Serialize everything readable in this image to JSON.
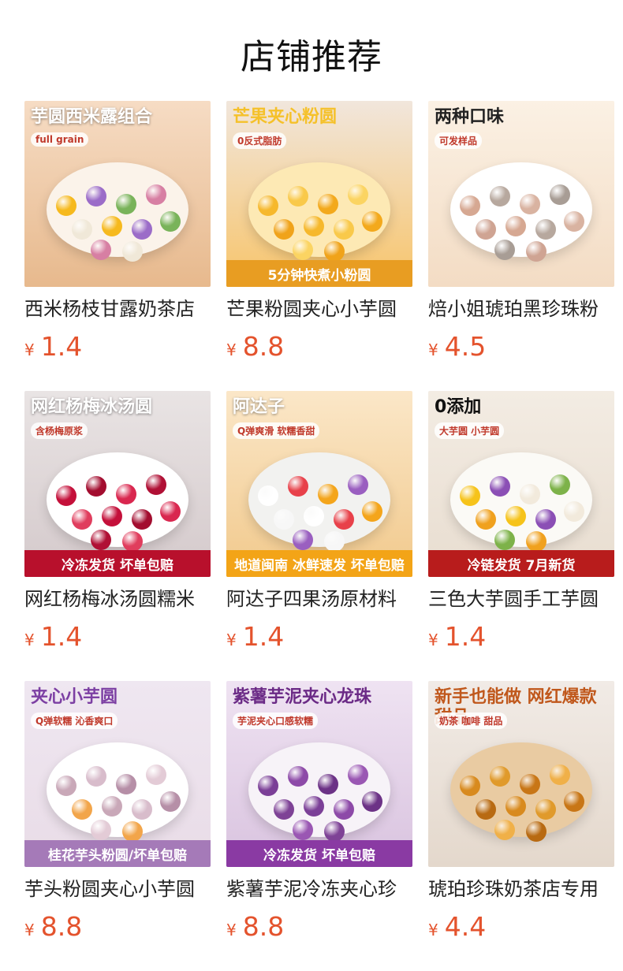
{
  "page_title": "店铺推荐",
  "currency": "¥",
  "products": [
    {
      "name": "西米杨枝甘露奶茶店",
      "price": "1.4",
      "image": {
        "headline": "芋圆西米露组合",
        "sub": "full grain",
        "banner": "",
        "top_color": "#f6dcc4",
        "bottom_color": "#e7b98d",
        "text_color": "#ffffff",
        "banner_color": "",
        "bowl_color": "#fbf3ea",
        "balls": [
          "#f6b91d",
          "#9b6cc8",
          "#79b35a",
          "#d77fa3",
          "#f0e8d8"
        ]
      }
    },
    {
      "name": "芒果粉圆夹心小芋圆",
      "price": "8.8",
      "image": {
        "headline": "芒果夹心粉圆",
        "sub": "0反式脂肪",
        "banner": "5分钟快煮小粉圆",
        "top_color": "#f1e6dc",
        "bottom_color": "#f7c46a",
        "text_color": "#f5c12a",
        "banner_color": "#e89d22",
        "bowl_color": "#fde9b4",
        "balls": [
          "#f6b82c",
          "#f9c94a",
          "#f3a91c",
          "#fbd462",
          "#f0a31a"
        ]
      }
    },
    {
      "name": "焙小姐琥珀黑珍珠粉",
      "price": "4.5",
      "image": {
        "headline": "两种口味",
        "sub": "可发样品",
        "banner": "",
        "top_color": "#fbf1e4",
        "bottom_color": "#f3dcc4",
        "text_color": "#222222",
        "banner_color": "",
        "bowl_color": "#ffffff",
        "balls": [
          "#d6a892",
          "#b7a89e",
          "#d9b3a1",
          "#a89d95",
          "#cfa493"
        ]
      }
    },
    {
      "name": "网红杨梅冰汤圆糯米",
      "price": "1.4",
      "image": {
        "headline": "网红杨梅冰汤圆",
        "sub": "含杨梅原浆",
        "banner": "冷冻发货 坏单包赔",
        "top_color": "#e9e4e4",
        "bottom_color": "#d4c9cb",
        "text_color": "#ffffff",
        "banner_color": "#b8102c",
        "bowl_color": "#ffffff",
        "balls": [
          "#c4103a",
          "#a30d2f",
          "#d9274f",
          "#b01035",
          "#e03d5d"
        ]
      }
    },
    {
      "name": "阿达子四果汤原材料",
      "price": "1.4",
      "image": {
        "headline": "阿达子",
        "sub": "Q弹爽滑 软糯香甜",
        "banner": "地道闽南 冰鲜速发 坏单包赔",
        "top_color": "#fbe7c8",
        "bottom_color": "#f1c98c",
        "text_color": "#ffffff",
        "banner_color": "#f3a417",
        "bowl_color": "#f2f2f0",
        "balls": [
          "#ffffff",
          "#e8414a",
          "#f4a51b",
          "#9a5fc0",
          "#f7f7f7"
        ]
      }
    },
    {
      "name": "三色大芋圆手工芋圆",
      "price": "1.4",
      "image": {
        "headline": "0添加",
        "sub": "大芋圆 小芋圆",
        "banner": "冷链发货 7月新货",
        "top_color": "#f3ece3",
        "bottom_color": "#e8ddd0",
        "text_color": "#111111",
        "banner_color": "#b81c1c",
        "bowl_color": "#fbfaf6",
        "balls": [
          "#f6c31a",
          "#8b4fb5",
          "#f2eadc",
          "#7db249",
          "#f0a11e"
        ]
      }
    },
    {
      "name": "芋头粉圆夹心小芋圆",
      "price": "8.8",
      "image": {
        "headline": "夹心小芋圆",
        "sub": "Q弹软糯 沁香爽口",
        "banner": "桂花芋头粉圆/坏单包赔",
        "top_color": "#efe7f1",
        "bottom_color": "#e9dce7",
        "text_color": "#7c3fa3",
        "banner_color": "#a57ab8",
        "bowl_color": "#ffffff",
        "balls": [
          "#c9a8b8",
          "#d8bccb",
          "#b68fa7",
          "#e3cbd6",
          "#f2a54a"
        ]
      }
    },
    {
      "name": "紫薯芋泥冷冻夹心珍",
      "price": "8.8",
      "image": {
        "headline": "紫薯芋泥夹心龙珠",
        "sub": "芋泥夹心口感软糯",
        "banner": "冷冻发货 坏单包赔",
        "top_color": "#efe3f2",
        "bottom_color": "#d9c3df",
        "text_color": "#6b2a86",
        "banner_color": "#8a3aa3",
        "bowl_color": "#f7f3f8",
        "balls": [
          "#7b3f97",
          "#8d4aa8",
          "#6c3286",
          "#9a57b3",
          "#7e4296"
        ]
      }
    },
    {
      "name": "琥珀珍珠奶茶店专用",
      "price": "4.4",
      "image": {
        "headline": "新手也能做 网红爆款甜品",
        "sub": "奶茶 咖啡 甜品",
        "banner": "",
        "top_color": "#f1ebe6",
        "bottom_color": "#e4d8cc",
        "text_color": "#c0581c",
        "banner_color": "",
        "bowl_color": "#e9cba2",
        "balls": [
          "#d88a1e",
          "#e09a2b",
          "#c87616",
          "#f0b048",
          "#b86a12"
        ]
      }
    }
  ]
}
